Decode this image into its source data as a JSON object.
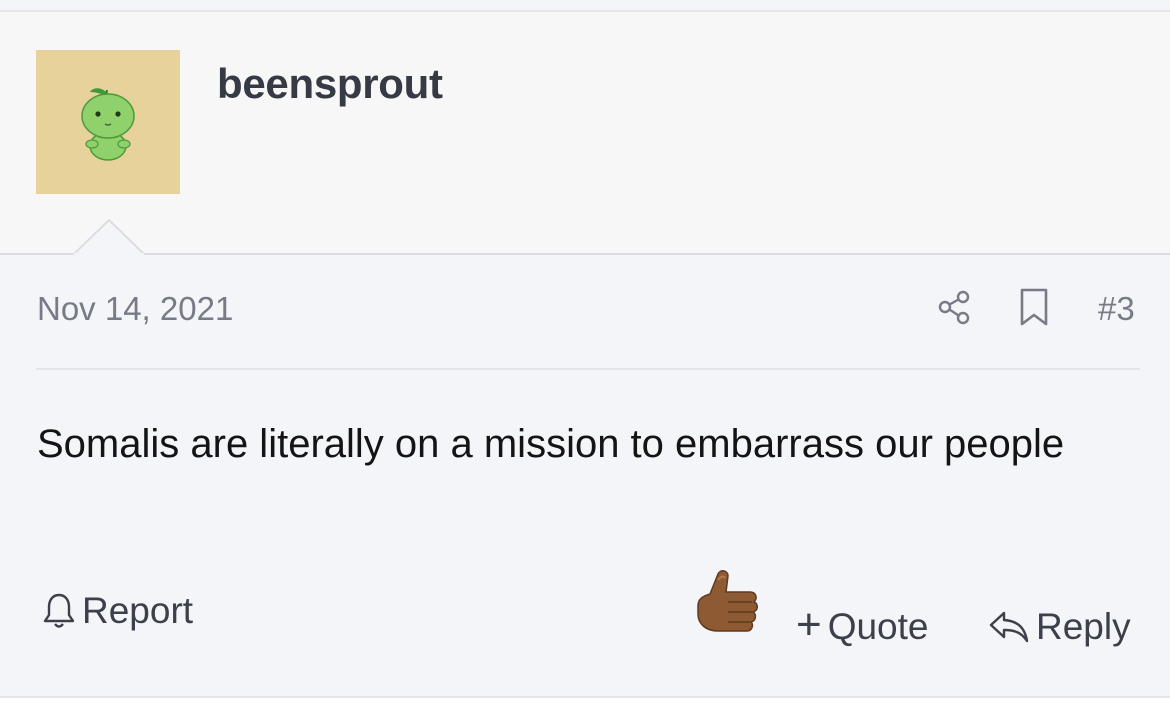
{
  "post": {
    "username": "beensprout",
    "date": "Nov 14, 2021",
    "number": "#3",
    "body": "Somalis are literally on a mission to embarrass our people"
  },
  "actions": {
    "report_label": "Report",
    "quote_label": "Quote",
    "quote_prefix": "+",
    "reply_label": "Reply"
  },
  "icons": {
    "share": "share-icon",
    "bookmark": "bookmark-icon",
    "report": "bell-icon",
    "reply": "reply-arrow-icon",
    "reaction": "thumbs-up-emoji"
  },
  "colors": {
    "page_background": "#f4f5f8",
    "header_background": "#f7f7f8",
    "avatar_background": "#e8d29c",
    "username_text": "#353a45",
    "meta_text": "#767b85",
    "body_text": "#141414"
  }
}
